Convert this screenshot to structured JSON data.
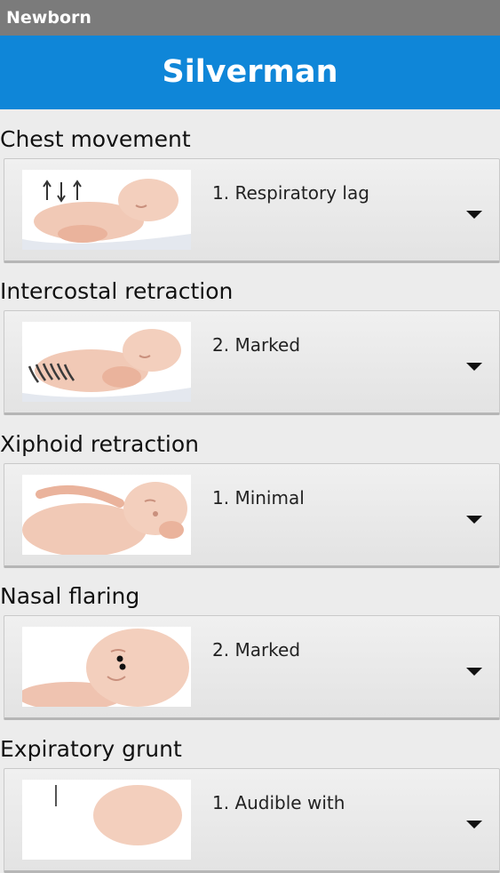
{
  "appbar": {
    "title": "Newborn"
  },
  "header": {
    "title": "Silverman"
  },
  "sections": [
    {
      "label": "Chest movement",
      "selected": "1. Respiratory lag",
      "image": "infant-chest-movement-illustration"
    },
    {
      "label": "Intercostal retraction",
      "selected": "2. Marked",
      "image": "infant-intercostal-retraction-illustration"
    },
    {
      "label": "Xiphoid retraction",
      "selected": "1. Minimal",
      "image": "infant-xiphoid-retraction-illustration"
    },
    {
      "label": "Nasal flaring",
      "selected": "2. Marked",
      "image": "infant-nasal-flaring-illustration"
    },
    {
      "label": "Expiratory grunt",
      "selected": "1. Audible with",
      "image": "infant-expiratory-grunt-illustration"
    }
  ],
  "colors": {
    "appbar": "#7b7b7b",
    "header": "#0f86d8",
    "background": "#ececec"
  },
  "icons": {
    "dropdown": "caret-down-icon"
  }
}
